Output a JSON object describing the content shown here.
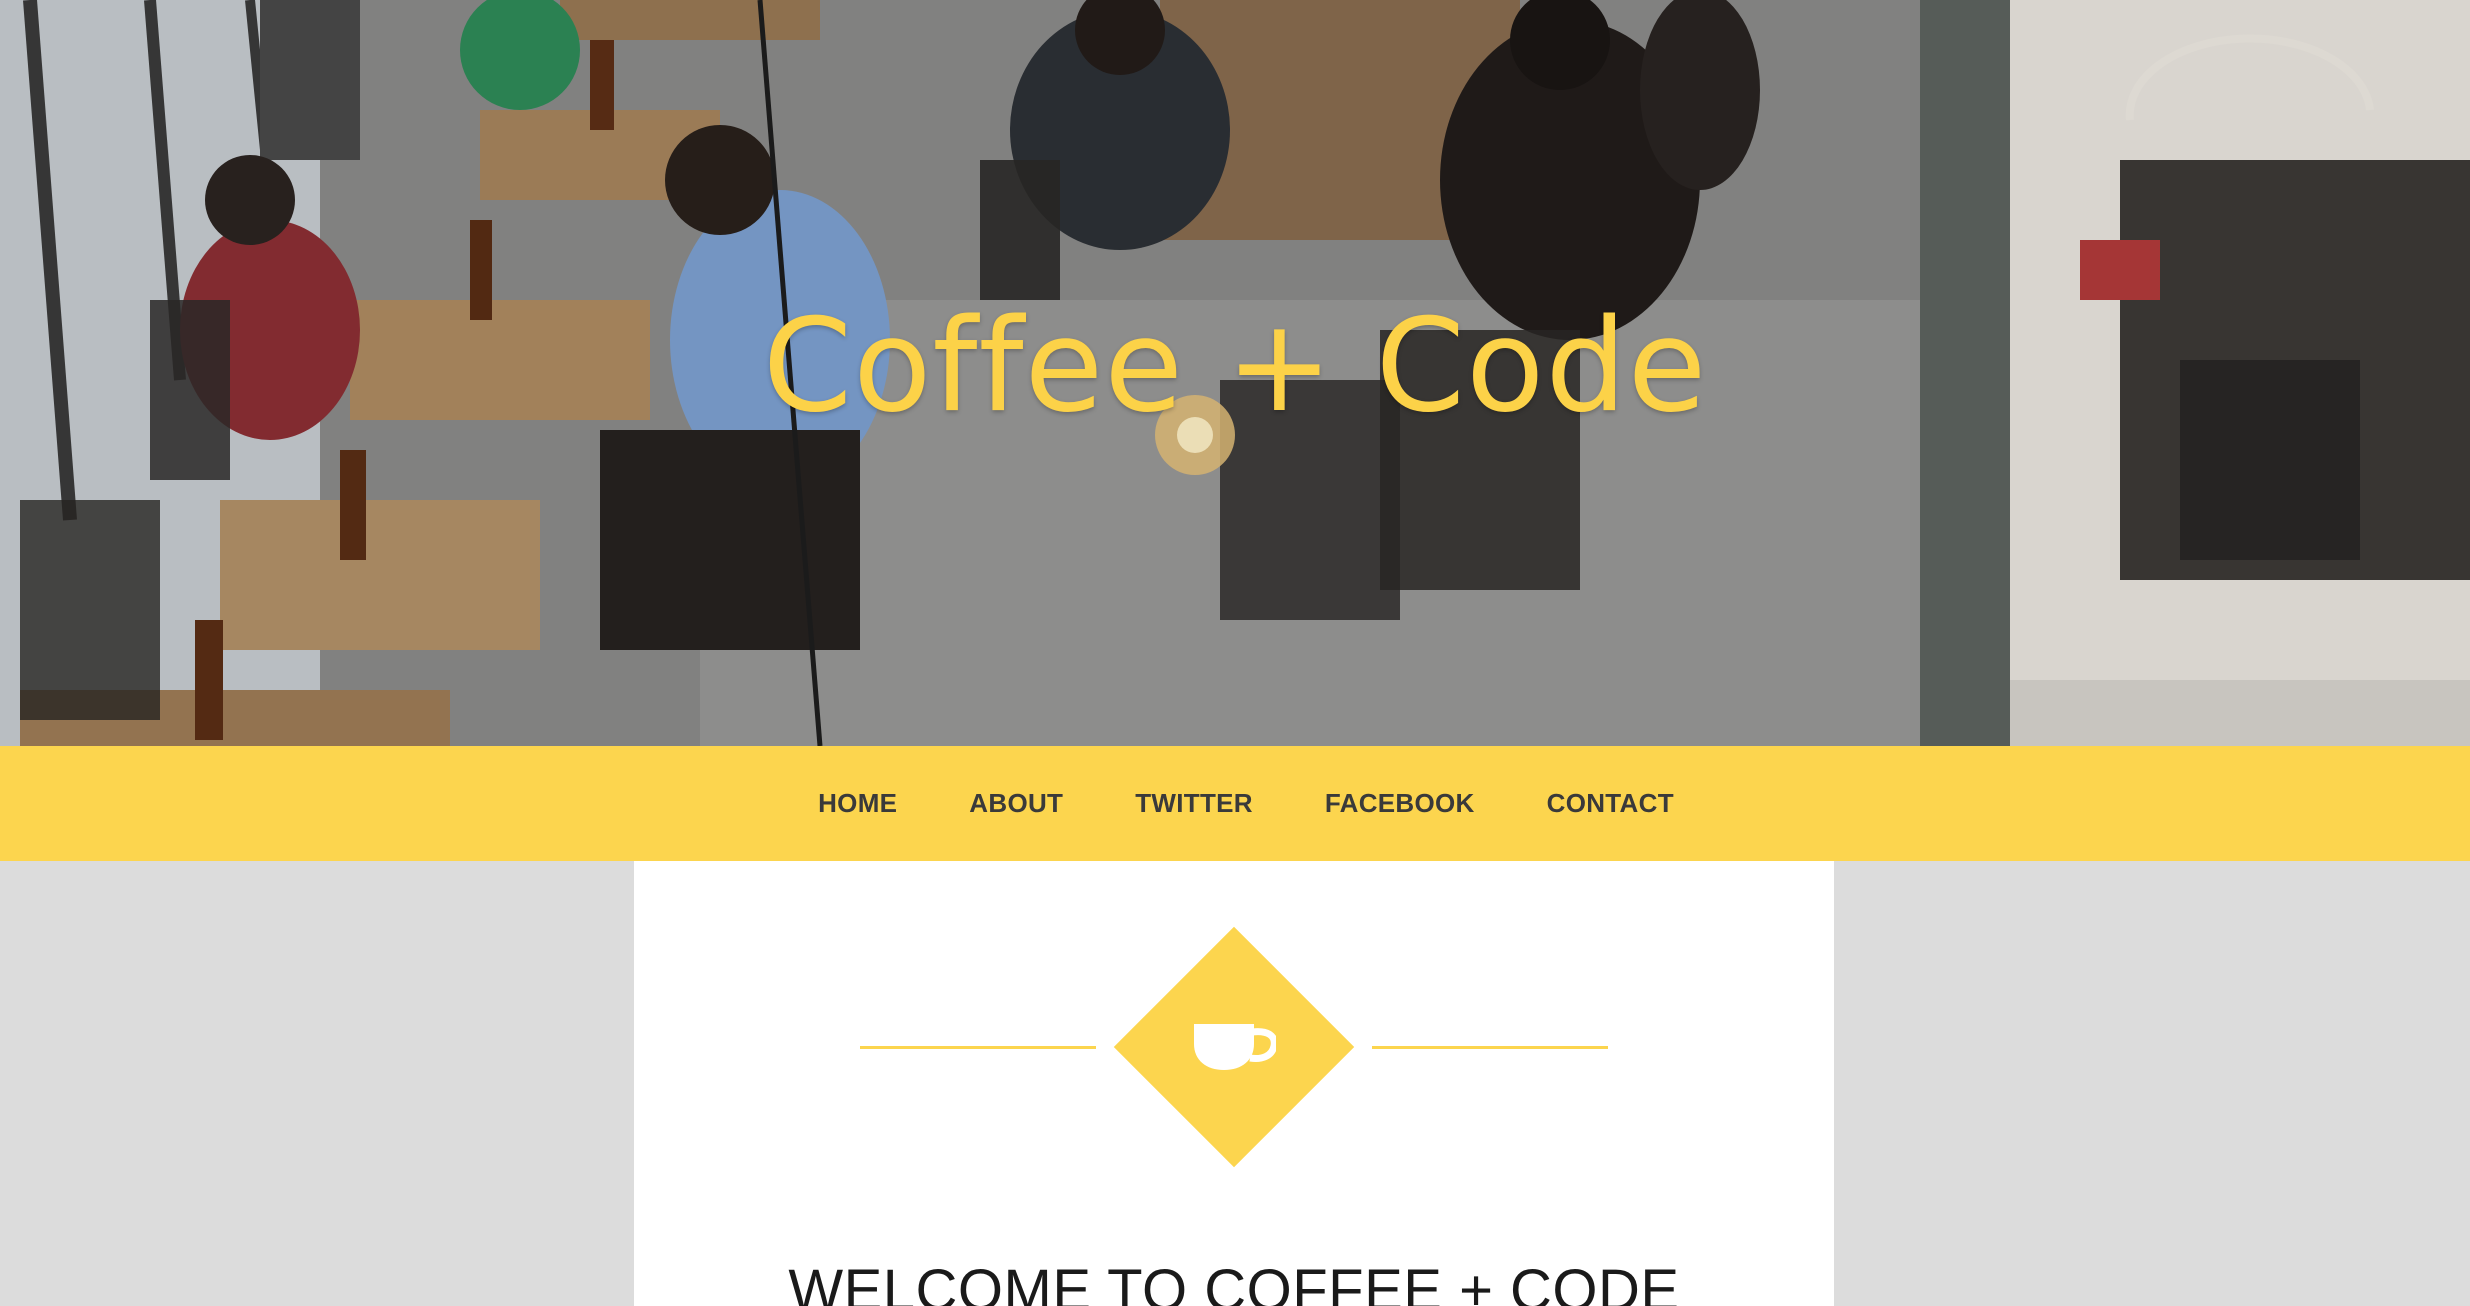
{
  "hero": {
    "title": "Coffee + Code",
    "image": "cafe-interior-photo"
  },
  "nav": {
    "items": [
      {
        "label": "HOME"
      },
      {
        "label": "ABOUT"
      },
      {
        "label": "TWITTER"
      },
      {
        "label": "FACEBOOK"
      },
      {
        "label": "CONTACT"
      }
    ]
  },
  "content": {
    "icon": "coffee-cup-icon",
    "heading": "WELCOME TO COFFEE + CODE"
  },
  "colors": {
    "accent": "#fcd54e",
    "title": "#fcd248",
    "nav_text": "#3a3a3a",
    "page_background": "#dcdcdc",
    "card_background": "#ffffff"
  }
}
